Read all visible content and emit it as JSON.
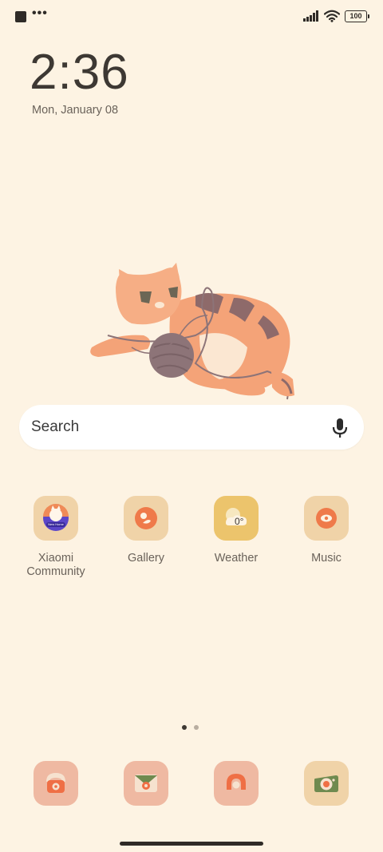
{
  "status_bar": {
    "battery": "100"
  },
  "lock": {
    "time": "2:36",
    "date": "Mon, January 08"
  },
  "search": {
    "label": "Search"
  },
  "apps": [
    {
      "label": "Xiaomi Community",
      "icon": "xiaomi-community-icon",
      "badge_text": "New Home"
    },
    {
      "label": "Gallery",
      "icon": "gallery-icon"
    },
    {
      "label": "Weather",
      "icon": "weather-icon",
      "temp": "0°"
    },
    {
      "label": "Music",
      "icon": "music-icon"
    }
  ],
  "dock": [
    {
      "icon": "phone-icon"
    },
    {
      "icon": "messages-icon"
    },
    {
      "icon": "browser-icon"
    },
    {
      "icon": "camera-icon"
    }
  ],
  "pages": {
    "current": 1,
    "total": 2
  },
  "colors": {
    "background": "#fdf3e3",
    "icon_tile": "#f0d3a8",
    "weather_tile": "#ecc46c",
    "accent_orange": "#ef8a57",
    "dot_active": "#3d3833",
    "dot_inactive": "#b8ada0"
  }
}
